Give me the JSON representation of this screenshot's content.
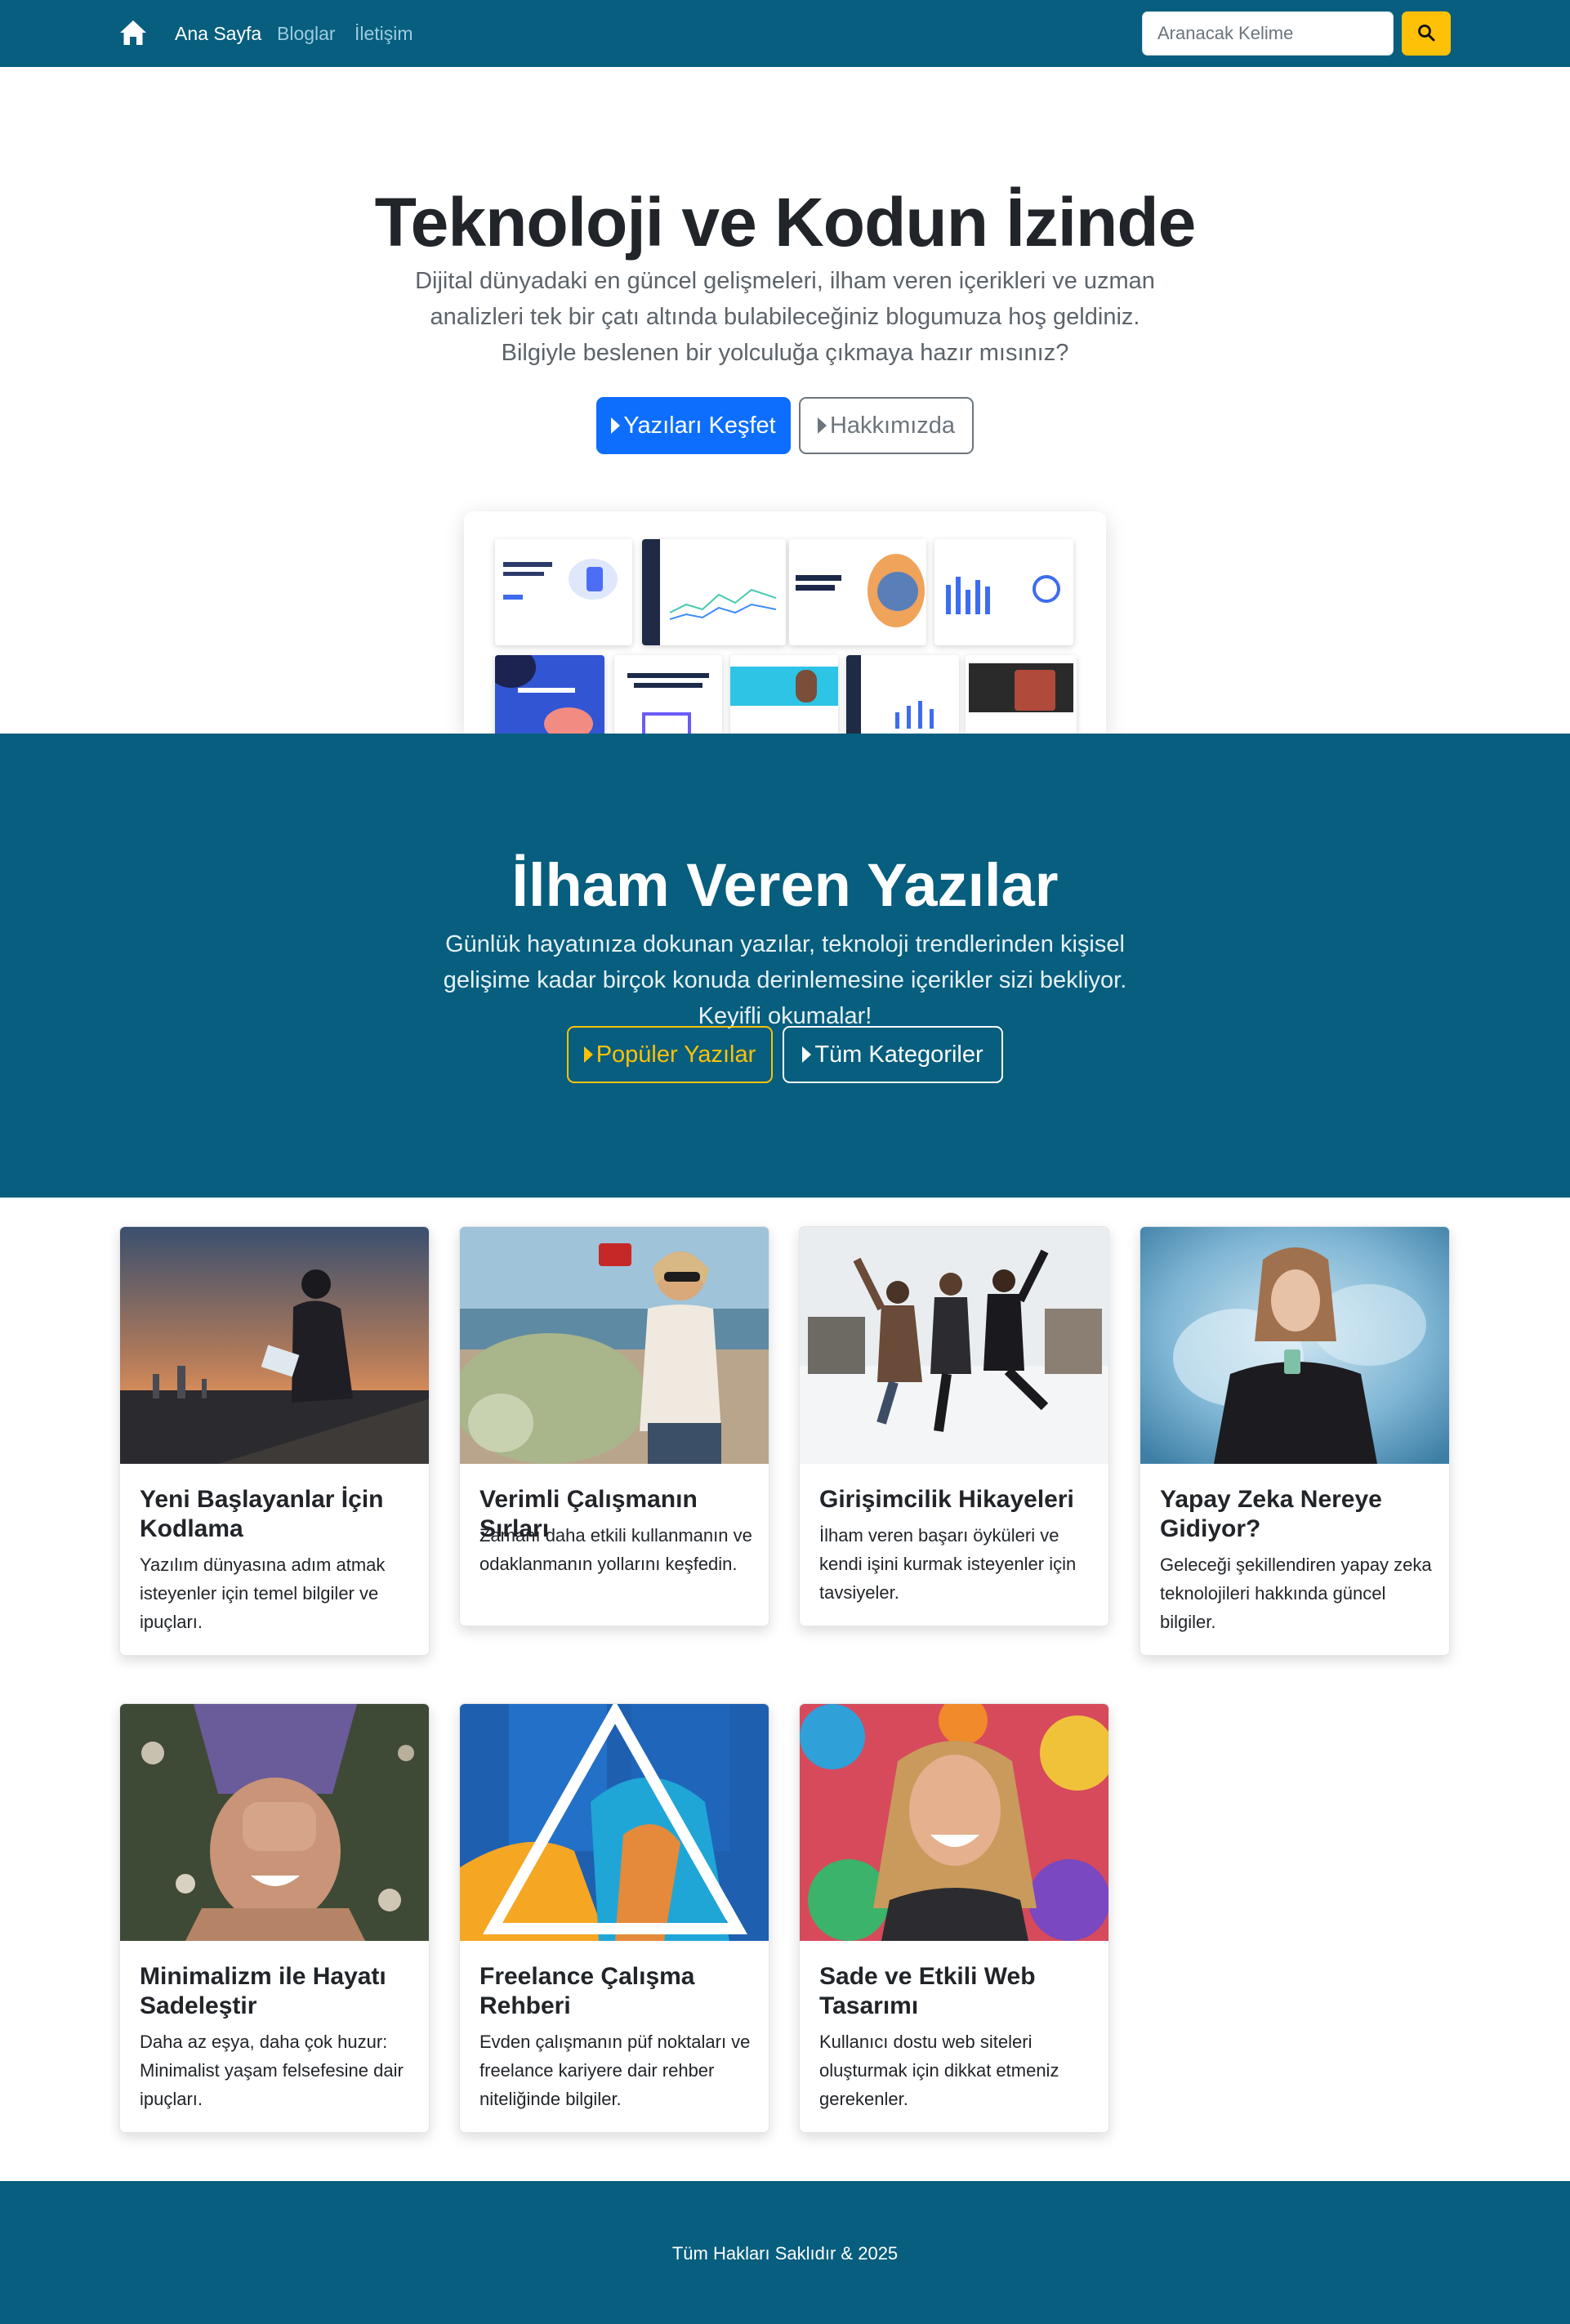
{
  "nav": {
    "home_icon": "home-icon",
    "links": [
      "Ana Sayfa",
      "Bloglar",
      "İletişim"
    ],
    "active_link": "Ana Sayfa",
    "search_placeholder": "Aranacak Kelime",
    "search_button_icon": "search-icon"
  },
  "hero": {
    "title": "Teknoloji ve Kodun İzinde",
    "lead": "Dijital dünyadaki en güncel gelişmeleri, ilham veren içerikleri ve uzman analizleri tek bir çatı altında bulabileceğiniz blogumuza hoş geldiniz. Bilgiyle beslenen bir yolculuğa çıkmaya hazır mısınız?",
    "primary_button": "Yazıları Keşfet",
    "secondary_button": "Hakkımızda"
  },
  "band": {
    "title": "İlham Veren Yazılar",
    "lead": "Günlük hayatınıza dokunan yazılar, teknoloji trendlerinden kişisel gelişime kadar birçok konuda derinlemesine içerikler sizi bekliyor. Keyifli okumalar!",
    "popular_button": "Popüler Yazılar",
    "categories_button": "Tüm Kategoriler"
  },
  "posts": [
    {
      "title": "Yeni Başlayanlar İçin Kodlama",
      "text": "Yazılım dünyasına adım atmak isteyenler için temel bilgiler ve ipuçları."
    },
    {
      "title": "Verimli Çalışmanın Sırları",
      "text": "Zamanı daha etkili kullanmanın ve odaklanmanın yollarını keşfedin."
    },
    {
      "title": "Girişimcilik Hikayeleri",
      "text": "İlham veren başarı öyküleri ve kendi işini kurmak isteyenler için tavsiyeler."
    },
    {
      "title": "Yapay Zeka Nereye Gidiyor?",
      "text": "Geleceği şekillendiren yapay zeka teknolojileri hakkında güncel bilgiler."
    },
    {
      "title": "Minimalizm ile Hayatı Sadeleştir",
      "text": "Daha az eşya, daha çok huzur: Minimalist yaşam felsefesine dair ipuçları."
    },
    {
      "title": "Freelance Çalışma Rehberi",
      "text": "Evden çalışmanın püf noktaları ve freelance kariyere dair rehber niteliğinde bilgiler."
    },
    {
      "title": "Sade ve Etkili Web Tasarımı",
      "text": "Kullanıcı dostu web siteleri oluşturmak için dikkat etmeniz gerekenler."
    }
  ],
  "footer": {
    "text": "Tüm Hakları Saklıdır & 2025"
  },
  "colors": {
    "brand": "#075e7e",
    "primary": "#0d6efd",
    "warning": "#ffc107"
  }
}
